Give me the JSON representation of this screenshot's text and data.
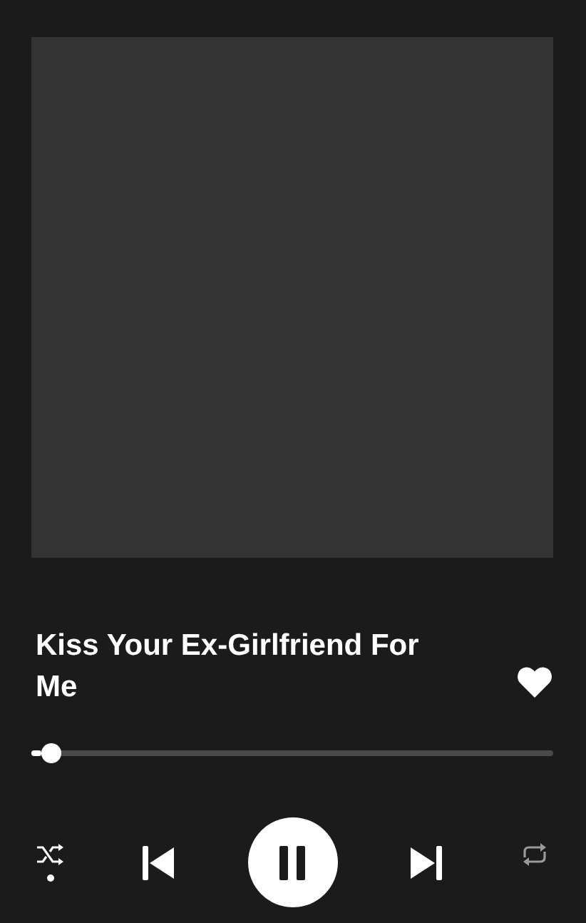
{
  "track": {
    "title": "Kiss Your Ex-Girlfriend For Me",
    "liked": true
  },
  "progress": {
    "level": 0.02
  },
  "controls": {
    "shuffle": true,
    "playing": true,
    "repeat": false
  }
}
